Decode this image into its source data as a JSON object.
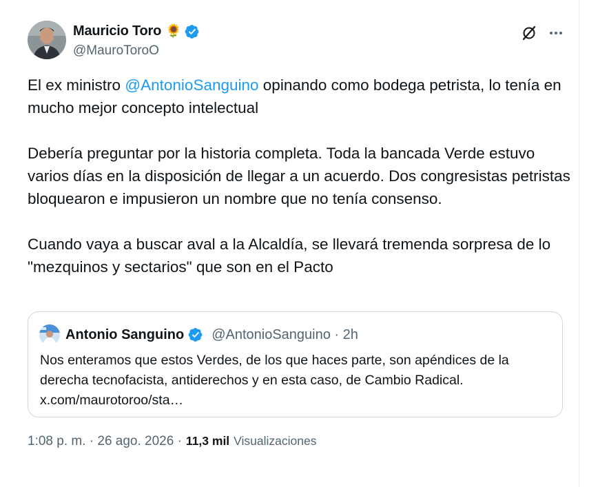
{
  "author": {
    "display_name": "Mauricio Toro",
    "emoji": "🌻",
    "handle": "@MauroToroO"
  },
  "icons": {
    "verified": "verified-badge-icon",
    "grok": "grok-icon",
    "more": "more-icon"
  },
  "tweet": {
    "p1_prefix": "El ex ministro ",
    "p1_mention": "@AntonioSanguino",
    "p1_suffix": " opinando como bodega petrista, lo tenía en mucho mejor concepto intelectual",
    "p2": "Debería preguntar por la historia completa. Toda la bancada Verde estuvo varios días en la disposición de llegar a un acuerdo. Dos congresistas petristas bloquearon e impusieron un nombre que no tenía consenso.",
    "p3": "Cuando vaya a buscar aval a la Alcaldía, se llevará tremenda sorpresa de lo \"mezquinos y sectarios\" que son en el Pacto"
  },
  "quote": {
    "display_name": "Antonio Sanguino",
    "handle_time": "@AntonioSanguino · 2h",
    "text": "Nos enteramos que estos Verdes, de los que haces parte, son apéndices de la derecha tecnofacista, antiderechos y en esta caso, de Cambio Radical. x.com/maurotoroo/sta…"
  },
  "footer": {
    "timestamp": "1:08 p. m. · 26 ago. 2026 ·",
    "views_count": "11,3 mil",
    "views_label": "Visualizaciones"
  },
  "colors": {
    "accent": "#1d9bf0",
    "text": "#0f1419",
    "secondary": "#536471",
    "border": "#cfd9de"
  }
}
